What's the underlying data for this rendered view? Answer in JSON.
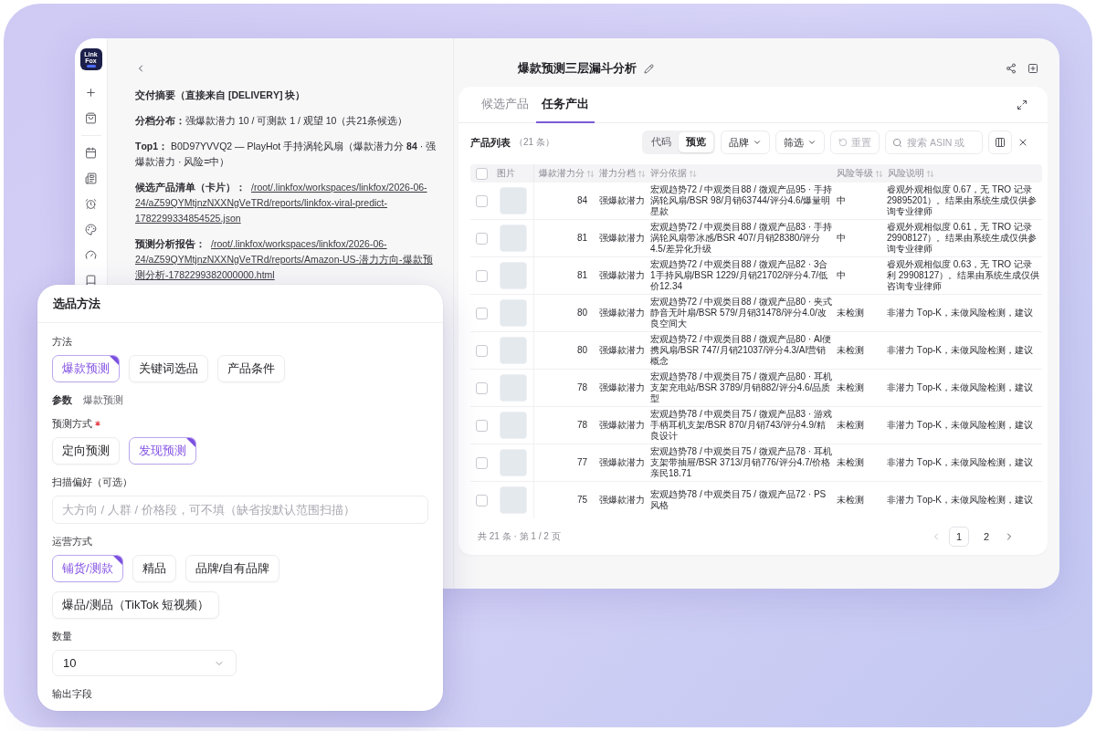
{
  "rail": {
    "logo_text": "Link Fox"
  },
  "chat": {
    "blocks": [
      {
        "kind": "heading",
        "text": "交付摘要（直接来自 [DELIVERY] 块）"
      },
      {
        "kind": "text",
        "text": "**分档分布：**强爆款潜力 10 / 可测款 1 / 观望 10（共21条候选）"
      },
      {
        "kind": "text",
        "text": "**Top1：** B0D97YVVQ2 — PlayHot 手持涡轮风扇（爆款潜力分 **84** · 强爆款潜力 · 风险=中）"
      },
      {
        "kind": "link",
        "label": "候选产品清单（卡片）：",
        "link": "/root/.linkfox/workspaces/linkfox/2026-06-24/aZ59QYMtjnzNXXNgVeTRd/reports/linkfox-viral-predict-1782299334854525.json"
      },
      {
        "kind": "link",
        "label": "预测分析报告：",
        "link": "/root/.linkfox/workspaces/linkfox/2026-06-24/aZ59QYMtjnzNXXNgVeTRd/reports/Amazon-US-潜力方向-爆款预测分析-1782299382000000.html"
      }
    ]
  },
  "header": {
    "title": "爆款预测三层漏斗分析"
  },
  "tabs": [
    {
      "label": "候选产品",
      "selected": false
    },
    {
      "label": "任务产出",
      "selected": true
    }
  ],
  "toolbar": {
    "title": "产品列表",
    "count": "（21 条）",
    "view_modes": [
      {
        "label": "代码",
        "selected": false
      },
      {
        "label": "预览",
        "selected": true
      }
    ],
    "buttons": [
      {
        "kind": "dropdown",
        "label": "品牌",
        "disabled": false
      },
      {
        "kind": "dropdown",
        "label": "筛选",
        "disabled": false
      },
      {
        "kind": "reset",
        "label": "重置",
        "disabled": true
      }
    ],
    "search": {
      "placeholder": "搜索 ASIN 或"
    }
  },
  "table": {
    "all_checked": false,
    "columns": [
      {
        "label": "图片",
        "sortable": false
      },
      {
        "label": "爆款潜力分",
        "sortable": true
      },
      {
        "label": "潜力分档",
        "sortable": true
      },
      {
        "label": "评分依据",
        "sortable": true
      },
      {
        "label": "风险等级",
        "sortable": true
      },
      {
        "label": "风险说明",
        "sortable": true
      }
    ],
    "rows": [
      {
        "checked": false,
        "score": "84",
        "tier": "强爆款潜力",
        "basis": "宏观趋势72 / 中观类目88 / 微观产品95 · 手持涡轮风扇/BSR 98/月销63744/评分4.6/爆量明星款",
        "risk_level": "中",
        "risk_note": "睿观外观相似度 0.67，无 TRO 记录29895201）。结果由系统生成仅供参询专业律师"
      },
      {
        "checked": false,
        "score": "81",
        "tier": "强爆款潜力",
        "basis": "宏观趋势72 / 中观类目88 / 微观产品83 · 手持涡轮风扇带冰感/BSR 407/月销28380/评分4.5/差异化升级",
        "risk_level": "中",
        "risk_note": "睿观外观相似度 0.61，无 TRO 记录29908127）。结果由系统生成仅供参询专业律师"
      },
      {
        "checked": false,
        "score": "81",
        "tier": "强爆款潜力",
        "basis": "宏观趋势72 / 中观类目88 / 微观产品82 · 3合1手持风扇/BSR 1229/月销21702/评分4.7/低价12.34",
        "risk_level": "中",
        "risk_note": "睿观外观相似度 0.63，无 TRO 记录利 29908127）。结果由系统生成仅供咨询专业律师"
      },
      {
        "checked": false,
        "score": "80",
        "tier": "强爆款潜力",
        "basis": "宏观趋势72 / 中观类目88 / 微观产品80 · 夹式静音无叶扇/BSR 579/月销31478/评分4.0/改良空间大",
        "risk_level": "未检测",
        "risk_note": "非潜力 Top-K，未做风险检测，建议"
      },
      {
        "checked": false,
        "score": "80",
        "tier": "强爆款潜力",
        "basis": "宏观趋势72 / 中观类目88 / 微观产品80 · AI便携风扇/BSR 747/月销21037/评分4.3/AI营销概念",
        "risk_level": "未检测",
        "risk_note": "非潜力 Top-K，未做风险检测，建议"
      },
      {
        "checked": false,
        "score": "78",
        "tier": "强爆款潜力",
        "basis": "宏观趋势78 / 中观类目75 / 微观产品80 · 耳机支架充电站/BSR 3789/月销882/评分4.6/品质型",
        "risk_level": "未检测",
        "risk_note": "非潜力 Top-K，未做风险检测，建议"
      },
      {
        "checked": false,
        "score": "78",
        "tier": "强爆款潜力",
        "basis": "宏观趋势78 / 中观类目75 / 微观产品83 · 游戏手柄耳机支架/BSR 870/月销743/评分4.9/精良设计",
        "risk_level": "未检测",
        "risk_note": "非潜力 Top-K，未做风险检测，建议"
      },
      {
        "checked": false,
        "score": "77",
        "tier": "强爆款潜力",
        "basis": "宏观趋势78 / 中观类目75 / 微观产品78 · 耳机支架带抽屉/BSR 3713/月销776/评分4.7/价格亲民18.71",
        "risk_level": "未检测",
        "risk_note": "非潜力 Top-K，未做风险检测，建议"
      },
      {
        "checked": false,
        "score": "75",
        "tier": "强爆款潜力",
        "basis": "宏观趋势78 / 中观类目75 / 微观产品72 · PS风格",
        "risk_level": "未检测",
        "risk_note": "非潜力 Top-K，未做风险检测，建议"
      }
    ]
  },
  "footer": {
    "summary": "共 21 条 · 第 1 / 2 页",
    "pages": [
      {
        "label": "1",
        "selected": true
      },
      {
        "label": "2",
        "selected": false
      }
    ],
    "prev_disabled": true,
    "next_disabled": false
  },
  "selection_panel": {
    "title": "选品方法",
    "fields": [
      {
        "kind": "chips",
        "label": "方法",
        "required": false,
        "options": [
          {
            "label": "爆款预测",
            "selected": true
          },
          {
            "label": "关键词选品",
            "selected": false
          },
          {
            "label": "产品条件",
            "selected": false
          }
        ]
      },
      {
        "kind": "info",
        "label": "参数",
        "value": "爆款预测",
        "required": false
      },
      {
        "kind": "chips",
        "label": "预测方式",
        "required": true,
        "options": [
          {
            "label": "定向预测",
            "selected": false
          },
          {
            "label": "发现预测",
            "selected": true
          }
        ]
      },
      {
        "kind": "input",
        "label": "扫描偏好（可选）",
        "placeholder": "大方向 / 人群 / 价格段，可不填（缺省按默认范围扫描）",
        "required": false
      },
      {
        "kind": "chips",
        "label": "运营方式",
        "required": false,
        "options": [
          {
            "label": "铺货/测款",
            "selected": true
          },
          {
            "label": "精品",
            "selected": false
          },
          {
            "label": "品牌/自有品牌",
            "selected": false
          },
          {
            "label": "爆品/测品（TikTok 短视频）",
            "selected": false
          }
        ]
      },
      {
        "kind": "select",
        "label": "数量",
        "value": "10",
        "required": false
      },
      {
        "kind": "label",
        "label": "输出字段",
        "required": false
      }
    ]
  }
}
